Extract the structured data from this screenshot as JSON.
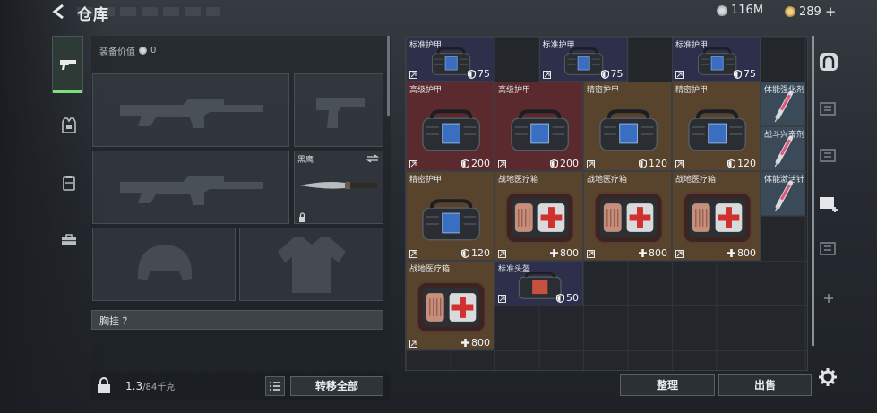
{
  "header": {
    "title": "仓库",
    "currency_silver": "116M",
    "currency_gold": "289",
    "plus": "+"
  },
  "equipment": {
    "value_label": "装备价值",
    "value_amount": "0",
    "knife_name": "黑鹰",
    "chest_label": "胸挂 ？",
    "weight_value": "1.3",
    "weight_capacity": "/84千克",
    "move_all_label": "转移全部"
  },
  "storage": {
    "items": [
      {
        "name": "标准护甲",
        "icon": "armor-bag-icon",
        "value": "75",
        "stat": "shield",
        "bg": "#2e2f4a"
      },
      {
        "name": "标准护甲",
        "icon": "armor-bag-icon",
        "value": "75",
        "stat": "shield",
        "bg": "#2e2f4a"
      },
      {
        "name": "标准护甲",
        "icon": "armor-bag-icon",
        "value": "75",
        "stat": "shield",
        "bg": "#2e2f4a"
      },
      {
        "name": "高级护甲",
        "icon": "armor-bag-icon",
        "value": "200",
        "stat": "shield",
        "bg": "#5a2a2e"
      },
      {
        "name": "高级护甲",
        "icon": "armor-bag-icon",
        "value": "200",
        "stat": "shield",
        "bg": "#5a2a2e"
      },
      {
        "name": "精密护甲",
        "icon": "armor-bag-icon",
        "value": "120",
        "stat": "shield",
        "bg": "#58432d"
      },
      {
        "name": "精密护甲",
        "icon": "armor-bag-icon",
        "value": "120",
        "stat": "shield",
        "bg": "#58432d"
      },
      {
        "name": "体能强化剂",
        "icon": "syringe-icon",
        "value": "",
        "stat": "",
        "bg": "#3a4a58"
      },
      {
        "name": "战斗兴奋剂",
        "icon": "syringe-icon",
        "value": "",
        "stat": "",
        "bg": "#3a4a58"
      },
      {
        "name": "精密护甲",
        "icon": "armor-bag-icon",
        "value": "120",
        "stat": "shield",
        "bg": "#58432d"
      },
      {
        "name": "战地医疗箱",
        "icon": "medkit-icon",
        "value": "800",
        "stat": "heal",
        "bg": "#58432d"
      },
      {
        "name": "战地医疗箱",
        "icon": "medkit-icon",
        "value": "800",
        "stat": "heal",
        "bg": "#58432d"
      },
      {
        "name": "战地医疗箱",
        "icon": "medkit-icon",
        "value": "800",
        "stat": "heal",
        "bg": "#58432d"
      },
      {
        "name": "体能激活针",
        "icon": "syringe-icon",
        "value": "",
        "stat": "",
        "bg": "#3a4a58"
      },
      {
        "name": "战地医疗箱",
        "icon": "medkit-icon",
        "value": "800",
        "stat": "heal",
        "bg": "#58432d"
      },
      {
        "name": "标准头盔",
        "icon": "helmet-bag-icon",
        "value": "50",
        "stat": "shield",
        "bg": "#2e2f4a"
      }
    ],
    "sort_label": "整理",
    "sell_label": "出售"
  },
  "colors": {
    "accent_green": "#7ee07a",
    "standard": "#2e2f4a",
    "advanced": "#5a2a2e",
    "precision": "#58432d",
    "consumable": "#3a4a58"
  }
}
